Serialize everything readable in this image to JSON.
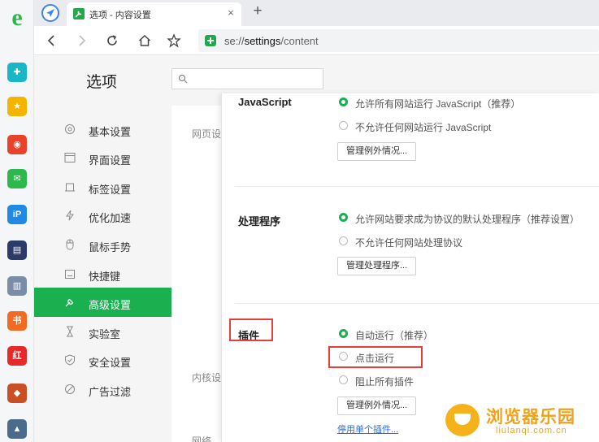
{
  "rail": {
    "logo": "e",
    "apps": [
      {
        "name": "plus-app-icon",
        "glyph": "✚",
        "color": "#19b6c6"
      },
      {
        "name": "star-app-icon",
        "glyph": "★",
        "color": "#f5b400"
      },
      {
        "name": "weibo-app-icon",
        "glyph": "◉",
        "color": "#e8412c"
      },
      {
        "name": "mail-app-icon",
        "glyph": "✉",
        "color": "#2db84b"
      },
      {
        "name": "ip-app-icon",
        "glyph": "iP",
        "color": "#1e8ae6"
      },
      {
        "name": "news-app-icon",
        "glyph": "▤",
        "color": "#2b3a67"
      },
      {
        "name": "doc-app-icon",
        "glyph": "▥",
        "color": "#7a8ca8"
      },
      {
        "name": "novel-app-icon",
        "glyph": "书",
        "color": "#f26b21"
      },
      {
        "name": "redbook-app-icon",
        "glyph": "红",
        "color": "#e62a2a"
      },
      {
        "name": "game-app-icon",
        "glyph": "◆",
        "color": "#c94f24"
      },
      {
        "name": "game2-app-icon",
        "glyph": "▲",
        "color": "#4a6b8c"
      }
    ]
  },
  "tab": {
    "title": "选项 - 内容设置",
    "close": "×",
    "new_tab": "+"
  },
  "address": {
    "scheme": "se://",
    "host": "settings",
    "path": "/content"
  },
  "page": {
    "title": "选项",
    "search_placeholder": ""
  },
  "sidebar": {
    "items": [
      {
        "label": "基本设置",
        "icon": "gear-icon"
      },
      {
        "label": "界面设置",
        "icon": "window-icon"
      },
      {
        "label": "标签设置",
        "icon": "tab-icon"
      },
      {
        "label": "优化加速",
        "icon": "lightning-icon"
      },
      {
        "label": "鼠标手势",
        "icon": "mouse-icon"
      },
      {
        "label": "快捷键",
        "icon": "keyboard-icon"
      },
      {
        "label": "高级设置",
        "icon": "wrench-icon",
        "active": true
      },
      {
        "label": "实验室",
        "icon": "hourglass-icon"
      },
      {
        "label": "安全设置",
        "icon": "shield-icon"
      },
      {
        "label": "广告过滤",
        "icon": "block-icon"
      }
    ]
  },
  "sections": {
    "webpage": "网页设",
    "kernel": "内核设",
    "network": "网络"
  },
  "dialog": {
    "javascript": {
      "heading": "JavaScript",
      "allow": "允许所有网站运行 JavaScript（推荐）",
      "deny": "不允许任何网站运行 JavaScript",
      "manage": "管理例外情况..."
    },
    "handlers": {
      "heading": "处理程序",
      "allow": "允许网站要求成为协议的默认处理程序（推荐设置）",
      "deny": "不允许任何网站处理协议",
      "manage": "管理处理程序..."
    },
    "plugins": {
      "heading": "插件",
      "auto": "自动运行（推荐）",
      "click": "点击运行",
      "block": "阻止所有插件",
      "manage": "管理例外情况...",
      "disable_link": "停用单个插件..."
    }
  },
  "watermark": {
    "cn": "浏览器乐园",
    "en": "liulanqi.com.cn"
  },
  "colors": {
    "accent_green": "#1aaf4f",
    "highlight_red": "#e53e3e",
    "link_blue": "#2a6bd6",
    "watermark_orange": "#f0a21b"
  }
}
